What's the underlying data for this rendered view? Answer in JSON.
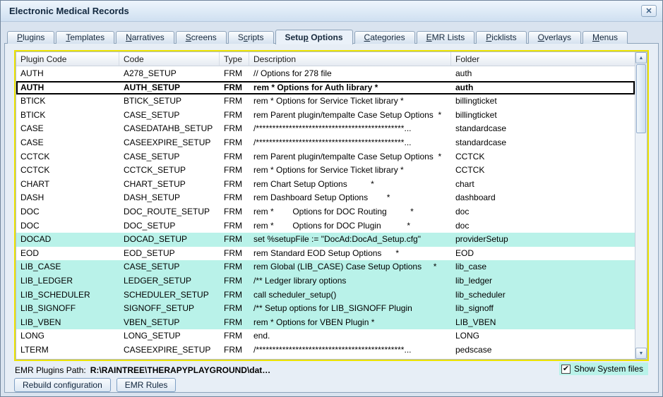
{
  "window": {
    "title": "Electronic Medical Records"
  },
  "icons": {
    "close": "✕",
    "scroll_up": "▲",
    "scroll_down": "▼",
    "check": "✔"
  },
  "colors": {
    "highlight_row": "#b9f2e9",
    "table_border": "#ece300",
    "checkbox_bg": "#b9f2e9"
  },
  "tabs": [
    {
      "label": "Plugins",
      "mnemonic": 0
    },
    {
      "label": "Templates",
      "mnemonic": 0
    },
    {
      "label": "Narratives",
      "mnemonic": 0
    },
    {
      "label": "Screens",
      "mnemonic": 0
    },
    {
      "label": "Scripts",
      "mnemonic": 1
    },
    {
      "label": "Setup Options",
      "mnemonic": 4,
      "active": true
    },
    {
      "label": "Categories",
      "mnemonic": 0
    },
    {
      "label": "EMR Lists",
      "mnemonic": 0
    },
    {
      "label": "Picklists",
      "mnemonic": 0
    },
    {
      "label": "Overlays",
      "mnemonic": 0
    },
    {
      "label": "Menus",
      "mnemonic": 0
    }
  ],
  "table": {
    "columns": [
      "Plugin Code",
      "Code",
      "Type",
      "Description",
      "Folder"
    ],
    "rows": [
      {
        "plugin": "AUTH",
        "code": "A278_SETUP",
        "type": "FRM",
        "desc": "// Options for 278 file",
        "folder": "auth"
      },
      {
        "plugin": "AUTH",
        "code": "AUTH_SETUP",
        "type": "FRM",
        "desc": "rem * Options for Auth library *",
        "folder": "auth",
        "selected": true
      },
      {
        "plugin": "BTICK",
        "code": "BTICK_SETUP",
        "type": "FRM",
        "desc": "rem * Options for Service Ticket library *",
        "folder": "billingticket"
      },
      {
        "plugin": "BTICK",
        "code": "CASE_SETUP",
        "type": "FRM",
        "desc": "rem Parent plugin/tempalte Case Setup Options  *",
        "folder": "billingticket"
      },
      {
        "plugin": "CASE",
        "code": "CASEDATAHB_SETUP",
        "type": "FRM",
        "desc": "/*********************************************...",
        "folder": "standardcase"
      },
      {
        "plugin": "CASE",
        "code": "CASEEXPIRE_SETUP",
        "type": "FRM",
        "desc": "/*********************************************...",
        "folder": "standardcase"
      },
      {
        "plugin": "CCTCK",
        "code": "CASE_SETUP",
        "type": "FRM",
        "desc": "rem Parent plugin/tempalte Case Setup Options  *",
        "folder": "CCTCK"
      },
      {
        "plugin": "CCTCK",
        "code": "CCTCK_SETUP",
        "type": "FRM",
        "desc": "rem * Options for Service Ticket library *",
        "folder": "CCTCK"
      },
      {
        "plugin": "CHART",
        "code": "CHART_SETUP",
        "type": "FRM",
        "desc": "rem Chart Setup Options          *",
        "folder": "chart"
      },
      {
        "plugin": "DASH",
        "code": "DASH_SETUP",
        "type": "FRM",
        "desc": "rem Dashboard Setup Options        *",
        "folder": "dashboard"
      },
      {
        "plugin": "DOC",
        "code": "DOC_ROUTE_SETUP",
        "type": "FRM",
        "desc": "rem *        Options for DOC Routing          *",
        "folder": "doc"
      },
      {
        "plugin": "DOC",
        "code": "DOC_SETUP",
        "type": "FRM",
        "desc": "rem *        Options for DOC Plugin           *",
        "folder": "doc"
      },
      {
        "plugin": "DOCAD",
        "code": "DOCAD_SETUP",
        "type": "FRM",
        "desc": "set %setupFile := \"DocAd:DocAd_Setup.cfg\"",
        "folder": "providerSetup",
        "cyan": true
      },
      {
        "plugin": "EOD",
        "code": "EOD_SETUP",
        "type": "FRM",
        "desc": "rem Standard EOD Setup Options      *",
        "folder": "EOD"
      },
      {
        "plugin": "LIB_CASE",
        "code": "CASE_SETUP",
        "type": "FRM",
        "desc": "rem Global (LIB_CASE) Case Setup Options     *",
        "folder": "lib_case",
        "cyan": true
      },
      {
        "plugin": "LIB_LEDGER",
        "code": "LEDGER_SETUP",
        "type": "FRM",
        "desc": "/** Ledger library options",
        "folder": "lib_ledger",
        "cyan": true
      },
      {
        "plugin": "LIB_SCHEDULER",
        "code": "SCHEDULER_SETUP",
        "type": "FRM",
        "desc": "call scheduler_setup()",
        "folder": "lib_scheduler",
        "cyan": true
      },
      {
        "plugin": "LIB_SIGNOFF",
        "code": "SIGNOFF_SETUP",
        "type": "FRM",
        "desc": "/** Setup options for LIB_SIGNOFF Plugin",
        "folder": "lib_signoff",
        "cyan": true
      },
      {
        "plugin": "LIB_VBEN",
        "code": "VBEN_SETUP",
        "type": "FRM",
        "desc": "rem * Options for VBEN Plugin *",
        "folder": "LIB_VBEN",
        "cyan": true
      },
      {
        "plugin": "LONG",
        "code": "LONG_SETUP",
        "type": "FRM",
        "desc": "end.",
        "folder": "LONG"
      },
      {
        "plugin": "LTERM",
        "code": "CASEEXPIRE_SETUP",
        "type": "FRM",
        "desc": "/*********************************************...",
        "folder": "pedscase"
      }
    ]
  },
  "footer": {
    "path_label": "EMR Plugins Path:",
    "path_value": "R:\\RAINTREE\\THERAPYPLAYGROUND\\dat…",
    "checkbox_label": "Show System files",
    "checkbox_checked": true,
    "buttons": [
      {
        "label": "Rebuild configuration",
        "name": "rebuild-configuration-button"
      },
      {
        "label": "EMR Rules",
        "name": "emr-rules-button"
      }
    ]
  }
}
